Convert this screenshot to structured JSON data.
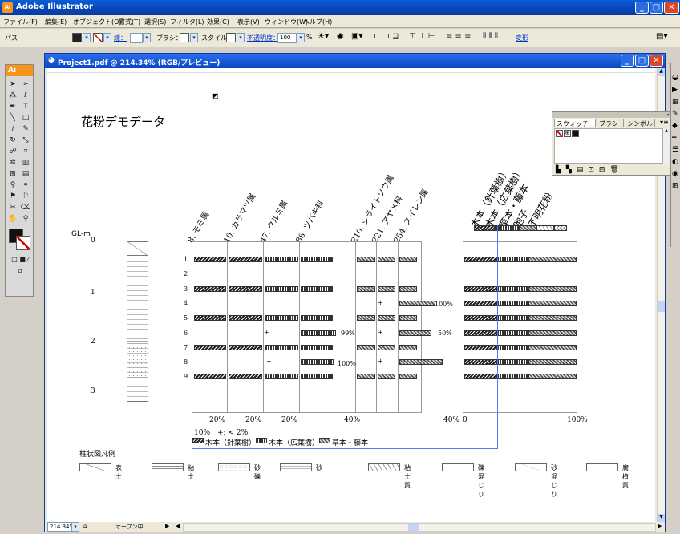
{
  "app": {
    "title": "Adobe Illustrator"
  },
  "menu": [
    "ファイル(F)",
    "編集(E)",
    "オブジェクト(O)",
    "書式(T)",
    "選択(S)",
    "フィルタ(L)",
    "効果(C)",
    "表示(V)",
    "ウィンドウ(W)",
    "ヘルプ(H)"
  ],
  "control": {
    "path_label": "パス",
    "stroke_label": "線：",
    "brush_label": "ブラシ：",
    "style_label": "スタイル：",
    "opacity_label": "不透明度：",
    "opacity_value": "100",
    "percent": "%",
    "transform_label": "変形"
  },
  "toolbox": {
    "header": "Ai"
  },
  "document": {
    "tab_title": "Project1.pdf @ 214.34% (RGB/プレビュー)",
    "zoom": "214.34%",
    "status": "オープン中"
  },
  "swatches": {
    "tabs": [
      "スウォッチ",
      "ブラシ",
      "シンボル"
    ]
  },
  "figure": {
    "title": "花粉デモデータ",
    "depth_label": "GL-m",
    "depth_ticks": [
      "0",
      "1",
      "2",
      "3"
    ],
    "sample_nos": [
      "1",
      "2",
      "3",
      "4",
      "5",
      "6",
      "7",
      "8",
      "9"
    ],
    "taxa": [
      "8. モミ属",
      "10. カラマツ属",
      "47. クルミ属",
      "86. ツバキ科",
      "210. シライトソウ属",
      "221. アヤメ科",
      "254. スイレン属"
    ],
    "summary_labels": [
      "木本（針葉樹）",
      "木本（広葉樹）",
      "草本・藤本",
      "胞子",
      "不明花粉"
    ],
    "axis_ticks": [
      "20%",
      "20%",
      "20%",
      "40%",
      "40%",
      "0",
      "100%"
    ],
    "pct_marks": [
      "100%",
      "99%",
      "50%",
      "100%"
    ],
    "plus": "+",
    "scale_note": "10%　+: < 2%",
    "legend_groups": [
      "木本（針葉樹）",
      "木本（広葉樹）",
      "草本・藤本"
    ],
    "column_legend_title": "柱状図凡例",
    "column_legend": [
      "表土",
      "粘土",
      "砂礫",
      "砂",
      "粘土質",
      "礫混じり",
      "砂混じり",
      "腐植質"
    ]
  }
}
